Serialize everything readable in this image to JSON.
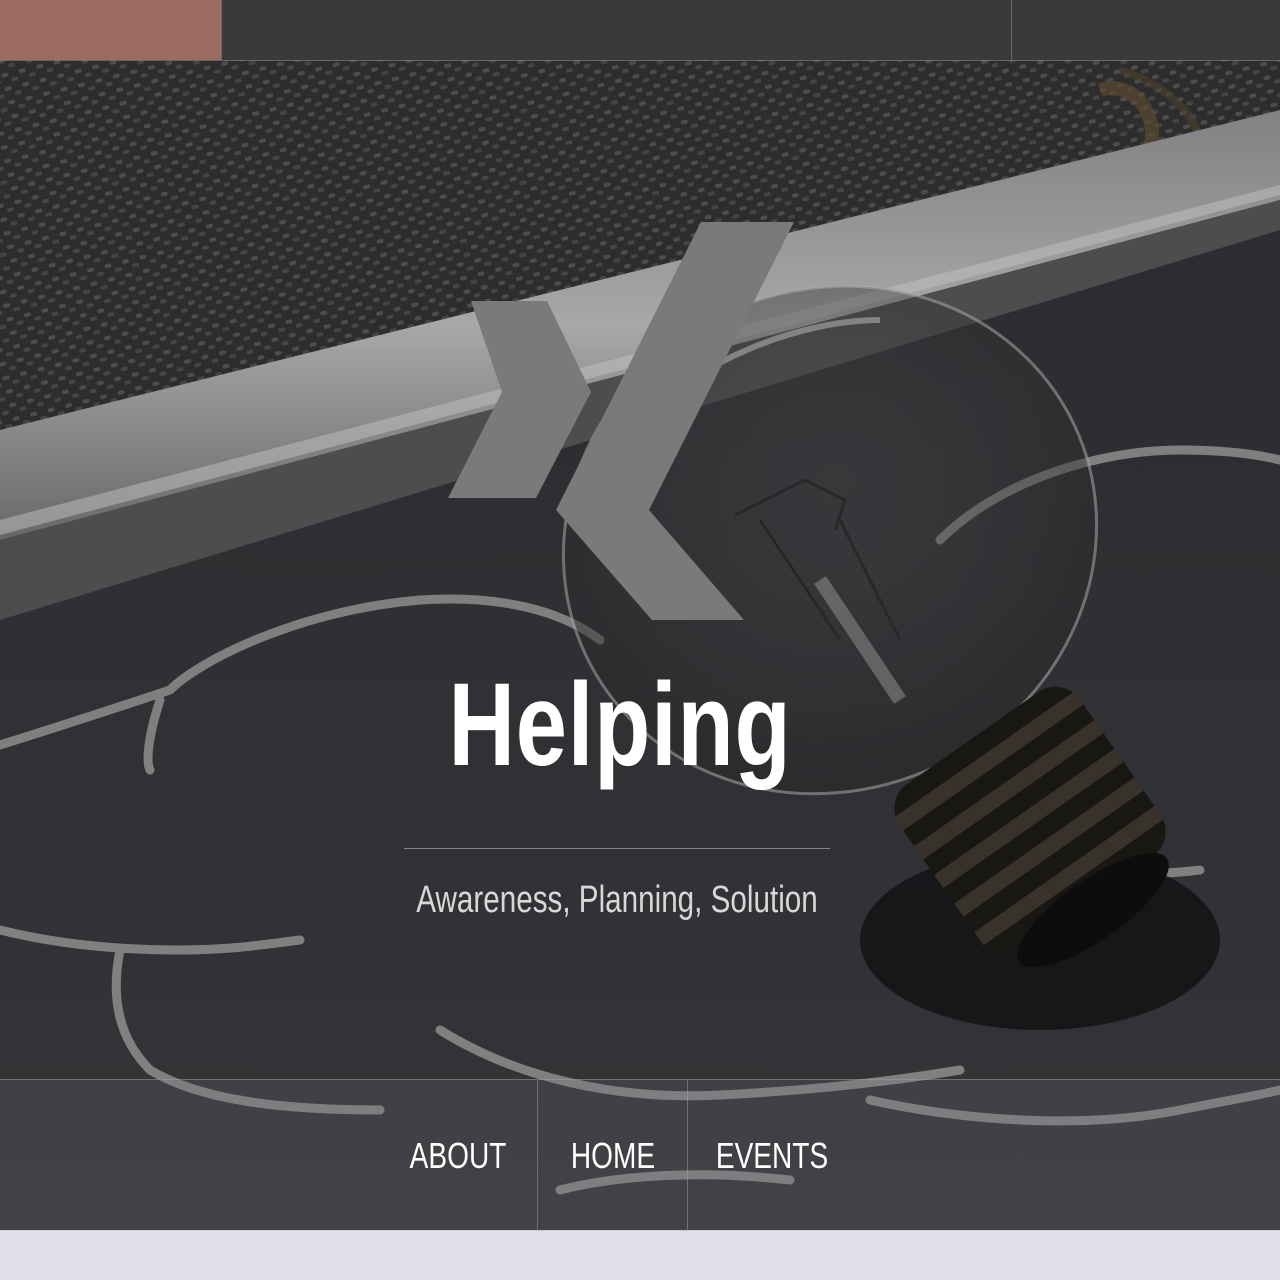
{
  "header": {
    "title": "Helping",
    "subtitle": "Awareness, Planning, Solution",
    "logo_icon": "xing-icon"
  },
  "nav": {
    "items": [
      {
        "label": "ABOUT"
      },
      {
        "label": "HOME"
      },
      {
        "label": "EVENTS"
      }
    ]
  },
  "colors": {
    "accent": "#9c6c61",
    "logo": "#7a7a7a",
    "footer": "#e2dfe8"
  }
}
